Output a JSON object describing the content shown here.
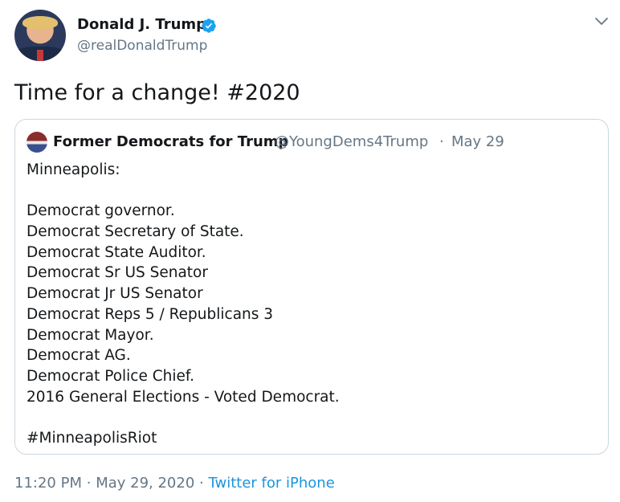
{
  "author": {
    "name": "Donald J. Trump",
    "handle": "@realDonaldTrump",
    "verified": true,
    "verified_color": "#1da1f2"
  },
  "tweet": {
    "text": "Time for a change! #2020"
  },
  "quoted_tweet": {
    "name": "Former Democrats for Trump",
    "handle": "@YoungDems4Trump",
    "separator": "·",
    "date": "May 29",
    "lines": [
      "Minneapolis:",
      "",
      "Democrat governor.",
      "Democrat Secretary of State.",
      "Democrat State Auditor.",
      "Democrat Sr US Senator",
      "Democrat Jr US Senator",
      "Democrat Reps 5 / Republicans 3",
      "Democrat Mayor.",
      "Democrat AG.",
      "Democrat Police Chief.",
      "2016 General Elections - Voted Democrat.",
      "",
      "#MinneapolisRiot"
    ]
  },
  "meta": {
    "time": "11:20 PM",
    "separator": "·",
    "date": "May 29, 2020",
    "source": "Twitter for iPhone"
  },
  "colors": {
    "text": "#14171a",
    "secondary": "#657786",
    "link": "#1b95e0",
    "border": "#ccd6dd"
  }
}
